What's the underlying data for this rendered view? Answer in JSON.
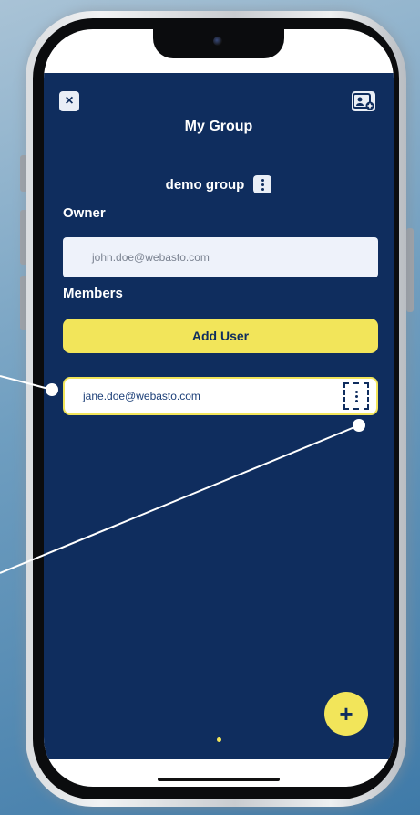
{
  "header": {
    "close_icon": "×",
    "add_contact_icon": "contact-card-plus",
    "title": "My Group"
  },
  "group": {
    "name": "demo group"
  },
  "owner": {
    "label": "Owner",
    "email": "john.doe@webasto.com"
  },
  "members": {
    "label": "Members",
    "add_button_label": "Add User",
    "items": [
      {
        "email": "jane.doe@webasto.com"
      }
    ]
  },
  "fab": {
    "icon": "+"
  },
  "colors": {
    "primary_navy": "#0f2d5e",
    "accent_yellow": "#f2e55a",
    "field_bg": "#eef2fa"
  }
}
